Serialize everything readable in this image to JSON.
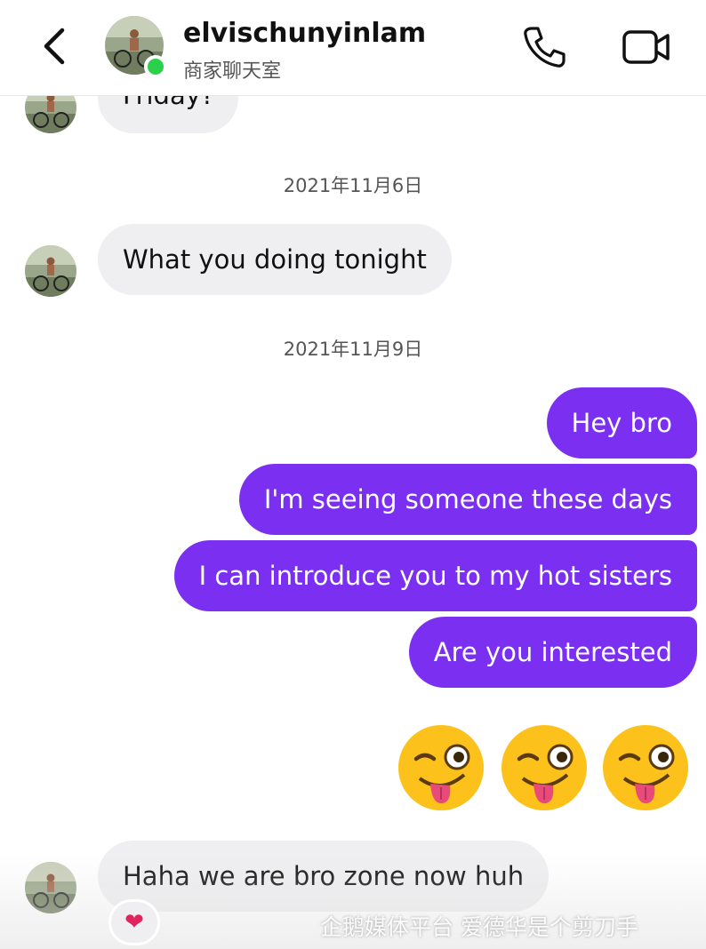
{
  "header": {
    "username": "elvischunyinlam",
    "subtitle": "商家聊天室",
    "status_color": "#2bd14a"
  },
  "icons": {
    "back": "chevron-left-icon",
    "call": "phone-icon",
    "video": "video-camera-icon",
    "reaction": "heart-icon"
  },
  "messages": {
    "partial_top": "Friday?",
    "date1": "2021年11月6日",
    "in1": "What you doing tonight",
    "date2": "2021年11月9日",
    "out1": "Hey bro",
    "out2": "I'm seeing someone these days",
    "out3": "I can introduce you to my hot sisters",
    "out4": "Are you interested",
    "emojis": "😜😜😜",
    "in2": "Haha we are bro zone now huh",
    "reaction": "❤"
  },
  "colors": {
    "outgoing_bubble": "#7b2ff0",
    "incoming_bubble": "#efeff1"
  },
  "watermark": "企鹅媒体平台 爱德华是个剪刀手"
}
